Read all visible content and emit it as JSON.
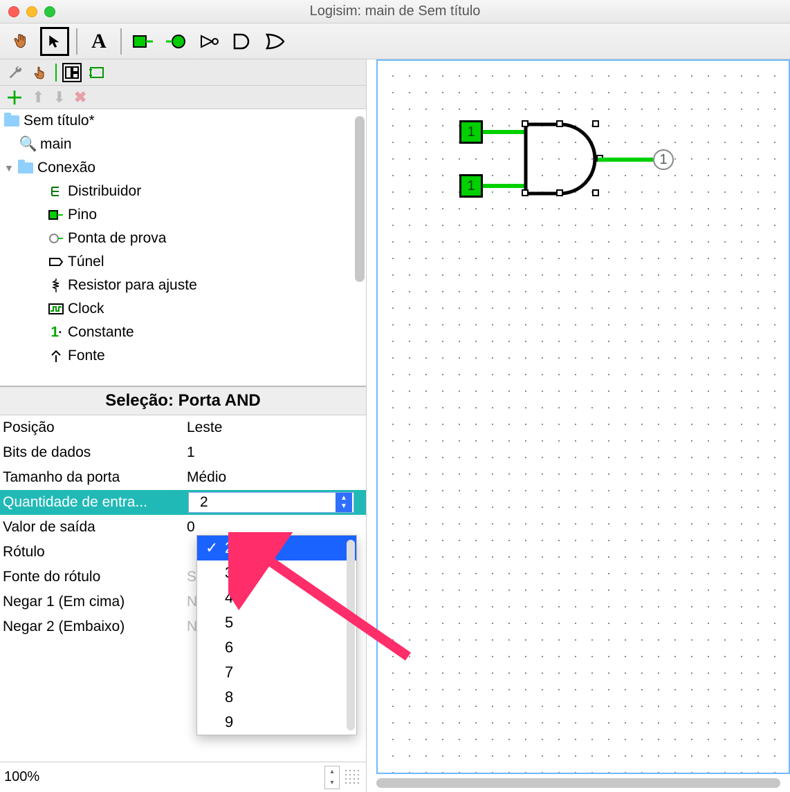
{
  "window": {
    "title": "Logisim: main de Sem título"
  },
  "toolbar": {
    "tools": [
      {
        "name": "poke-tool",
        "icon": "hand"
      },
      {
        "name": "select-tool",
        "icon": "arrow",
        "selected": true
      },
      {
        "name": "text-tool",
        "icon": "A"
      },
      {
        "name": "input-pin-tool",
        "icon": "input-pin"
      },
      {
        "name": "output-pin-tool",
        "icon": "output-pin"
      },
      {
        "name": "not-gate-tool",
        "icon": "not"
      },
      {
        "name": "and-gate-tool",
        "icon": "and"
      },
      {
        "name": "or-gate-tool",
        "icon": "or"
      }
    ]
  },
  "sidetools1": [
    {
      "name": "wrench-icon"
    },
    {
      "name": "poke-icon"
    },
    {
      "name": "layout-icon",
      "selected": true
    },
    {
      "name": "rect-icon"
    }
  ],
  "sidetools2": [
    {
      "name": "add-icon",
      "glyph": "+"
    },
    {
      "name": "up-icon",
      "glyph": "⬆"
    },
    {
      "name": "down-icon",
      "glyph": "⬇"
    },
    {
      "name": "delete-icon",
      "glyph": "✖"
    }
  ],
  "tree": {
    "project_label": "Sem título*",
    "circuit_label": "main",
    "folder_label": "Conexão",
    "items": [
      {
        "icon": "splitter",
        "label": "Distribuidor"
      },
      {
        "icon": "pin",
        "label": "Pino"
      },
      {
        "icon": "probe",
        "label": "Ponta de prova"
      },
      {
        "icon": "tunnel",
        "label": "Túnel"
      },
      {
        "icon": "pullres",
        "label": "Resistor para ajuste"
      },
      {
        "icon": "clock",
        "label": "Clock"
      },
      {
        "icon": "constant",
        "label": "Constante"
      },
      {
        "icon": "power",
        "label": "Fonte"
      }
    ]
  },
  "selection_header": "Seleção: Porta AND",
  "properties": [
    {
      "label": "Posição",
      "value": "Leste"
    },
    {
      "label": "Bits de dados",
      "value": "1"
    },
    {
      "label": "Tamanho da porta",
      "value": "Médio"
    },
    {
      "label": "Quantidade de entra...",
      "value": "2",
      "active": true,
      "combo": true
    },
    {
      "label": "Valor de saída",
      "value": "0"
    },
    {
      "label": "Rótulo",
      "value": ""
    },
    {
      "label": "Fonte do rótulo",
      "value": "SansSerif Normal"
    },
    {
      "label": "Negar 1 (Em cima)",
      "value": "Não"
    },
    {
      "label": "Negar 2 (Embaixo)",
      "value": "Não"
    }
  ],
  "dropdown": {
    "selected": "2",
    "options": [
      "2",
      "3",
      "4",
      "5",
      "6",
      "7",
      "8",
      "9"
    ]
  },
  "zoom": "100%",
  "circuit": {
    "input1": "1",
    "input2": "1",
    "output": "1"
  }
}
